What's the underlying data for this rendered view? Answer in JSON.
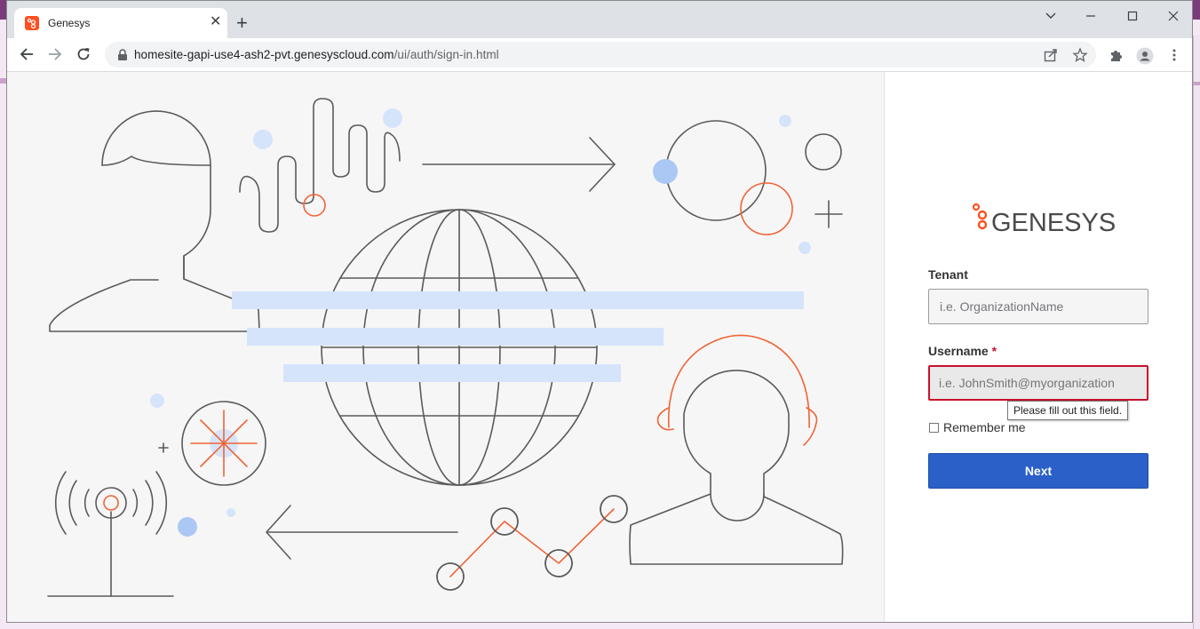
{
  "browser": {
    "tab_title": "Genesys",
    "new_tab_symbol": "+",
    "close_symbol": "✕",
    "url_host": "homesite-gapi-use4-ash2-pvt.genesyscloud.com",
    "url_path": "/ui/auth/sign-in.html"
  },
  "brand": {
    "logo_text": "GENESYS",
    "accent_color": "#FF4F1F",
    "button_color": "#2A60C8",
    "error_color": "#C8102E"
  },
  "form": {
    "tenant_label": "Tenant",
    "tenant_placeholder": "i.e. OrganizationName",
    "tenant_value": "",
    "username_label": "Username",
    "required_marker": "*",
    "username_placeholder": "i.e. JohnSmith@myorganization",
    "username_value": "",
    "validation_tooltip": "Please fill out this field.",
    "remember_label": "Remember me",
    "remember_checked": false,
    "next_label": "Next"
  }
}
